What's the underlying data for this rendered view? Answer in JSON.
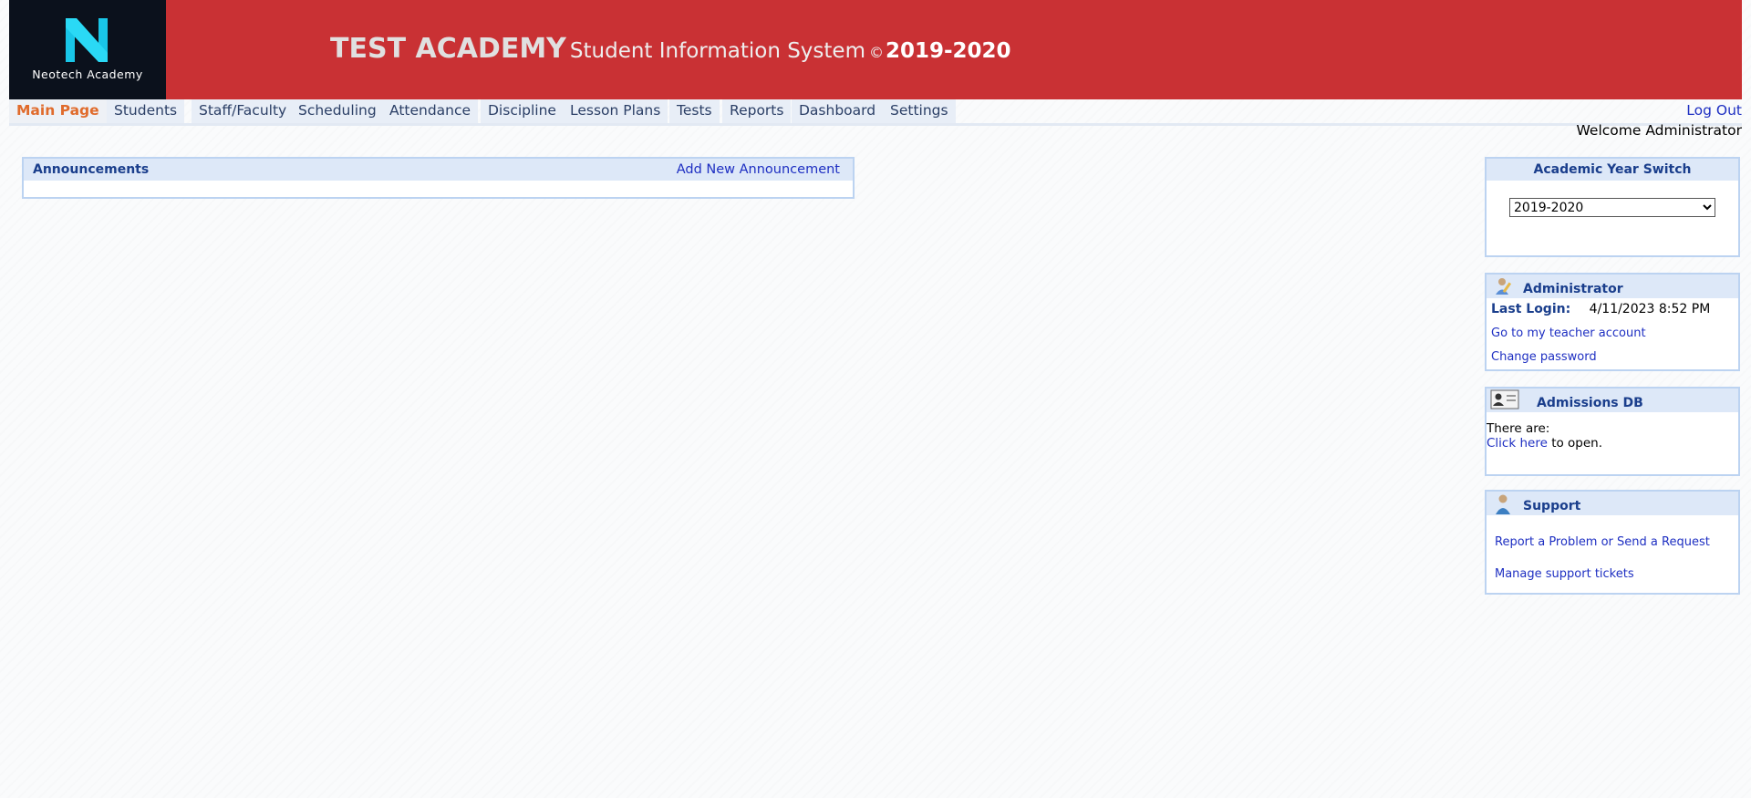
{
  "logo": {
    "text": "Neotech Academy",
    "icon": "neotech-n-logo"
  },
  "title": {
    "school": "TEST ACADEMY",
    "system": "Student Information System",
    "copyright": "©",
    "year": "2019-2020"
  },
  "nav": {
    "items": [
      {
        "label": "Main Page",
        "active": true
      },
      {
        "label": "Students"
      },
      {
        "label": "Staff/Faculty"
      },
      {
        "label": "Scheduling"
      },
      {
        "label": "Attendance"
      },
      {
        "label": "Discipline"
      },
      {
        "label": "Lesson Plans"
      },
      {
        "label": "Tests"
      },
      {
        "label": "Reports"
      },
      {
        "label": "Dashboard"
      },
      {
        "label": "Settings"
      }
    ],
    "logout": "Log Out"
  },
  "welcome": "Welcome Administrator",
  "announcements": {
    "title": "Announcements",
    "add_label": "Add New Announcement"
  },
  "academic_year": {
    "title": "Academic Year Switch",
    "selected": "2019-2020"
  },
  "admin": {
    "title": "Administrator",
    "last_login_label": "Last Login:",
    "last_login_value": "4/11/2023 8:52 PM",
    "teacher_link": "Go to my teacher account",
    "password_link": "Change password",
    "icon": "user-pencil-icon"
  },
  "admissions": {
    "title": "Admissions DB",
    "there_are": "There are:",
    "click_here": "Click here",
    "to_open": "to open.",
    "icon": "id-card-icon"
  },
  "support": {
    "title": "Support",
    "report_link": "Report a Problem or Send a Request",
    "manage_link": "Manage support tickets",
    "icon": "support-person-icon"
  },
  "colors": {
    "header": "#c93134",
    "logo_bg": "#0b111c",
    "accent_active": "#e06b2c",
    "link": "#1e2fc2",
    "panel_head": "#dde8f8"
  }
}
